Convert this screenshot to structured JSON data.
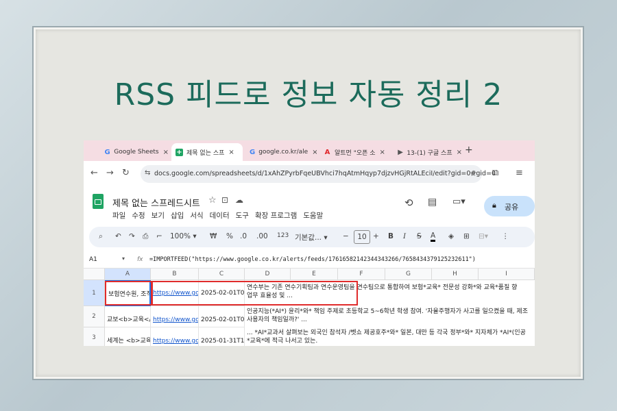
{
  "headline": "RSS 피드로 정보 자동 정리 2",
  "tabs": [
    {
      "icon": "google-icon",
      "label": "Google Sheets",
      "close": "×"
    },
    {
      "icon": "sheets-icon",
      "label": "제목 없는 스프",
      "close": "×"
    },
    {
      "icon": "google-icon",
      "label": "google.co.kr/ale",
      "close": "×"
    },
    {
      "icon": "acrobat-icon",
      "label": "알트먼 \"오픈 소",
      "close": "×"
    },
    {
      "icon": "youtube-icon",
      "label": "13-(1) 구글 스프",
      "close": "×"
    }
  ],
  "new_tab": "+",
  "address": {
    "url": "docs.google.com/spreadsheets/d/1xAhZPyrbFqeUBVhci7hqAtmHqyp7djzvHGjRtALEciI/edit?gid=0#gid=0"
  },
  "doc": {
    "title": "제목 없는 스프레드시트"
  },
  "menu": [
    "파일",
    "수정",
    "보기",
    "삽입",
    "서식",
    "데이터",
    "도구",
    "확장 프로그램",
    "도움말"
  ],
  "share_label": "공유",
  "toolbar": {
    "zoom": "100%",
    "currency": "₩",
    "percent": "%",
    "dec_minus": ".0",
    "dec_plus": ".00",
    "num_format": "123",
    "font": "기본값...",
    "font_size": "10"
  },
  "formula_bar": {
    "cell_ref": "A1",
    "fx": "fx",
    "formula": "=IMPORTFEED(\"https://www.google.co.kr/alerts/feeds/17616582142344343266/7658434379125232611\")"
  },
  "columns": [
    "A",
    "B",
    "C",
    "D",
    "E",
    "F",
    "G",
    "H",
    "I"
  ],
  "rows": [
    {
      "num": "1",
      "a": "보험연수원, 조직",
      "b": "https://www.goo",
      "c": "2025-02-01T03:",
      "d_line1": "연수부는 기존 연수기획팀과 연수운영팀을 연수팀으로 통합하여 보험*교육* 전문성 강화*와 교육*품질 향",
      "d_line2": "업무 효율성 및 ..."
    },
    {
      "num": "2",
      "a": "교보<b>교육</b",
      "b": "https://www.goo",
      "c": "2025-02-01T03:",
      "d_line1": "인공지능(*AI*) 윤리*와* 책임 주제로 초등학교 5~6학년 학생 참여. '자율주행자가 사고를 일으켰을 때, 제조",
      "d_line2": "사용자의 책임일까?' ..."
    },
    {
      "num": "3",
      "a": "세계는 <b>교육",
      "b": "https://www.goo",
      "c": "2025-01-31T16:",
      "d_line1": "... *AI*교과서 살펴보는 외국인 참석자 /벳쇼 제공호주*와* 일본, 대만 등 각국 정부*와* 지자체가 *AI*(인공",
      "d_line2": "*교육*에 적극 나서고 있는."
    }
  ],
  "colors": {
    "headline": "#1c6b5b",
    "highlight": "#e02b2b",
    "link": "#1155cc",
    "tabbar": "#f5dde3"
  }
}
